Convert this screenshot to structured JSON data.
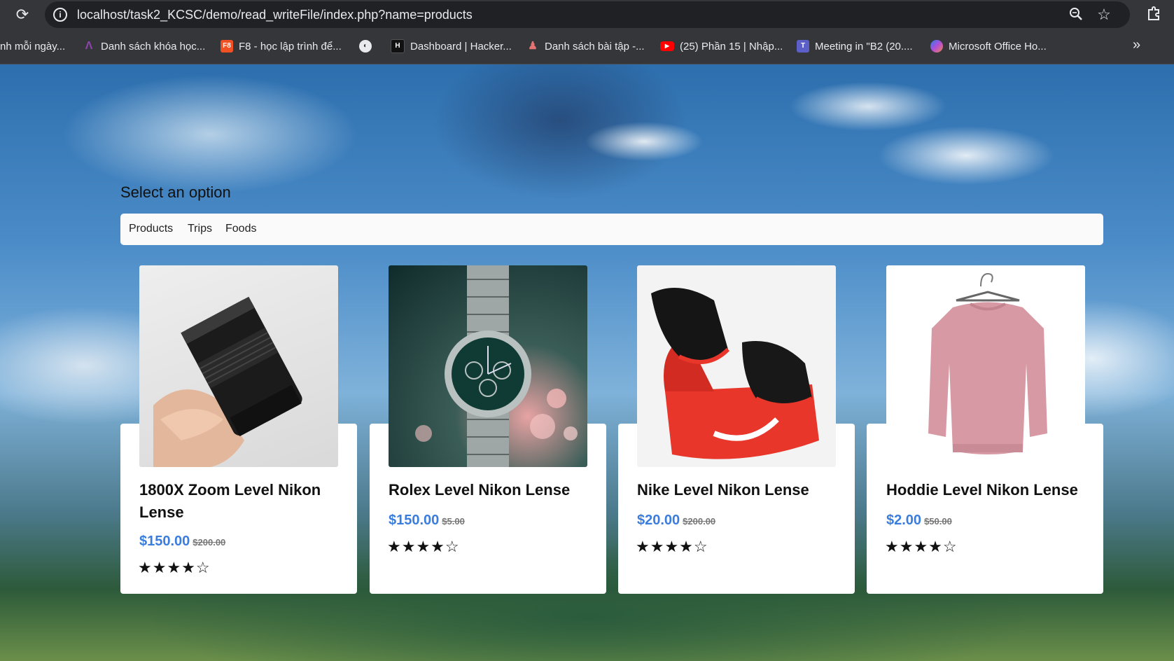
{
  "browser": {
    "url": "localhost/task2_KCSC/demo/read_writeFile/index.php?name=products",
    "bookmarks": [
      {
        "label": "nh mỗi ngày...",
        "icon": "none"
      },
      {
        "label": "Danh sách khóa học...",
        "icon": "course-icon"
      },
      {
        "label": "F8 - học lập trình để...",
        "icon": "f8-icon"
      },
      {
        "label": "",
        "icon": "globe-icon"
      },
      {
        "label": "Dashboard | Hacker...",
        "icon": "hackerrank-icon"
      },
      {
        "label": "Danh sách bài tập -...",
        "icon": "user-icon"
      },
      {
        "label": "(25) Phần 15 | Nhập...",
        "icon": "youtube-icon"
      },
      {
        "label": "Meeting in \"B2 (20....",
        "icon": "teams-icon"
      },
      {
        "label": "Microsoft Office Ho...",
        "icon": "office-icon"
      }
    ]
  },
  "page": {
    "select_title": "Select an option",
    "nav": [
      "Products",
      "Trips",
      "Foods"
    ]
  },
  "products": [
    {
      "title": "1800X Zoom Level Nikon Lense",
      "price": "$150.00",
      "old_price": "$200.00",
      "rating": 4,
      "max_rating": 5
    },
    {
      "title": "Rolex Level Nikon Lense",
      "price": "$150.00",
      "old_price": "$5.00",
      "rating": 4,
      "max_rating": 5
    },
    {
      "title": "Nike Level Nikon Lense",
      "price": "$20.00",
      "old_price": "$200.00",
      "rating": 4,
      "max_rating": 5
    },
    {
      "title": "Hoddie Level Nikon Lense",
      "price": "$2.00",
      "old_price": "$50.00",
      "rating": 4,
      "max_rating": 5
    }
  ],
  "stars": "★★★★☆"
}
